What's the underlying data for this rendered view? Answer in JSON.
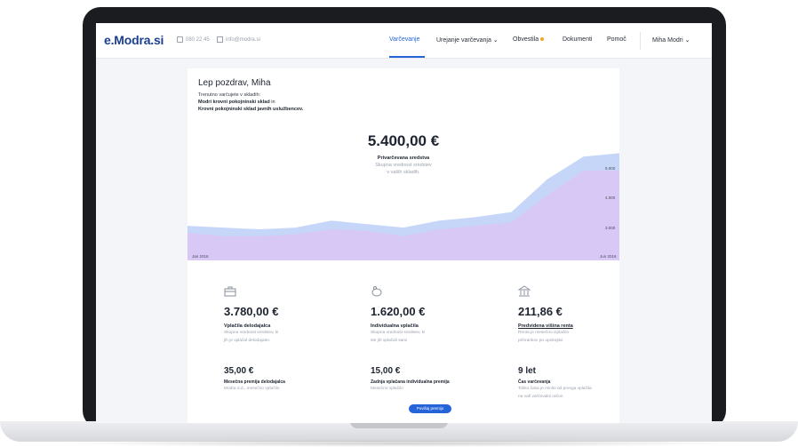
{
  "colors": {
    "brand": "#1c3f8f",
    "accent": "#2563d8",
    "notice_dot": "#f5a623",
    "chart_front": "#d8c7f5",
    "chart_back": "#c6d6f8"
  },
  "nav": {
    "logo": "e.Modra.si",
    "phone": "080 22 45",
    "email": "info@modra.si",
    "items": [
      {
        "label": "Varčevanje",
        "active": true
      },
      {
        "label": "Urejanje varčevanja",
        "has_dropdown": true
      },
      {
        "label": "Obvestila",
        "has_dot": true
      },
      {
        "label": "Dokumenti"
      },
      {
        "label": "Pomoč"
      }
    ],
    "user": "Miha Modri",
    "icons": {
      "phone": "phone-icon",
      "email": "mail-icon",
      "dropdown": "chevron-down-icon"
    }
  },
  "intro": {
    "greeting": "Lep pozdrav, Miha",
    "line1": "Trenutno varčujete v skladih:",
    "fund1": "Modri krovni pokojninski sklad",
    "line_in": "in",
    "fund2": "Krovni pokojninski sklad javnih uslužbencev."
  },
  "balance": {
    "value": "5.400,00 €",
    "label": "Privarčevana sredstva",
    "desc1": "Skupna vrednost sredstev",
    "desc2": "v vaših skladih."
  },
  "chart_data": {
    "type": "area",
    "x_start_label": "Jan 2016",
    "x_end_label": "Jun 2016",
    "y_ticks": [
      "5.000",
      "4.000",
      "3.000"
    ],
    "series": [
      {
        "values": [
          2800,
          2700,
          2700,
          2750,
          2900,
          2850,
          2700,
          2900,
          3000,
          3100,
          3900,
          4600,
          4600
        ]
      },
      {
        "values": [
          3000,
          2950,
          2900,
          2950,
          3150,
          3050,
          2950,
          3150,
          3250,
          3400,
          4350,
          5000,
          5100
        ]
      }
    ]
  },
  "stats": [
    {
      "icon": "briefcase-icon",
      "value": "3.780,00 €",
      "label": "Vplačila delodajalca",
      "desc1": "Skupna vrednost sredstev, ki",
      "desc2": "jih je vplačal delodajalec"
    },
    {
      "icon": "piggy-bank-icon",
      "value": "1.620,00 €",
      "label": "Individualna vplačila",
      "desc1": "Skupna vrednost sredstev, ki",
      "desc2": "ste jih vplačali sami"
    },
    {
      "icon": "bank-icon",
      "value": "211,86 €",
      "label": "Predvidena višina renta",
      "desc1": "Renta je mesečno izplačilo",
      "desc2": "prihrankov po upokojitvi"
    }
  ],
  "stats2": [
    {
      "value": "35,00 €",
      "label": "Mesečna premija delodajalca",
      "desc1": "Modra d.d., mesečno vplačilo"
    },
    {
      "value": "15,00 €",
      "label": "Zadnja vplačana individualna premija",
      "desc1": "Mesečno vplačilo"
    },
    {
      "value": "9 let",
      "label": "Čas varčevanja",
      "desc1": "Toliko časa je minilo od prvega vplačila",
      "desc2": "na vaš varčevalni račun."
    }
  ],
  "button": {
    "label": "Povišaj premijo"
  }
}
